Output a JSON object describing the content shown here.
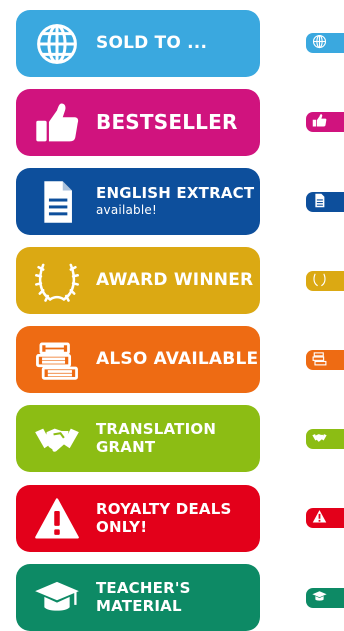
{
  "badges": [
    {
      "id": "sold-to",
      "label": "SOLD TO ...",
      "color": "#3aa8df",
      "icon": "globe-icon"
    },
    {
      "id": "bestseller",
      "label": "BESTSELLER",
      "color": "#d0137e",
      "icon": "thumbs-up-icon"
    },
    {
      "id": "english-extract",
      "label": "ENGLISH EXTRACT",
      "sub": "available!",
      "color": "#0d4f9c",
      "icon": "document-icon"
    },
    {
      "id": "award-winner",
      "label": "AWARD WINNER",
      "color": "#dba913",
      "icon": "laurel-wreath-icon"
    },
    {
      "id": "also-available",
      "label": "ALSO AVAILABLE",
      "color": "#ee6b13",
      "icon": "books-icon"
    },
    {
      "id": "translation-grant",
      "label": "TRANSLATION GRANT",
      "color": "#8cbd14",
      "icon": "handshake-icon"
    },
    {
      "id": "royalty-deals",
      "label": "ROYALTY DEALS ONLY!",
      "color": "#e3001a",
      "icon": "warning-icon"
    },
    {
      "id": "teachers-material",
      "label": "TEACHER'S MATERIAL",
      "color": "#0d8a65",
      "icon": "graduation-cap-icon"
    }
  ]
}
